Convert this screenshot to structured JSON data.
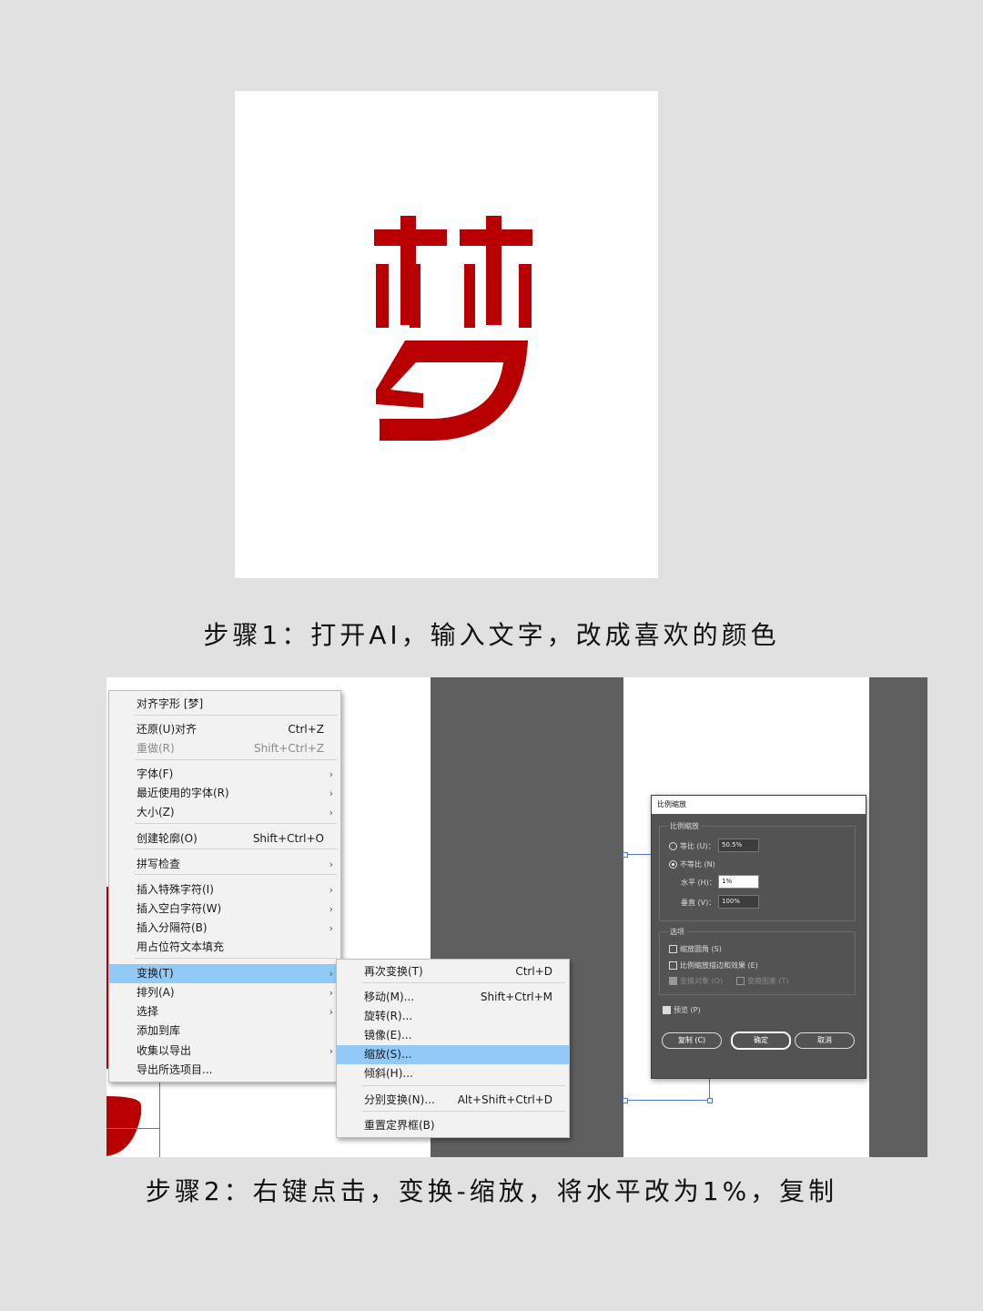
{
  "captions": {
    "step1": "步骤1：打开AI，输入文字，改成喜欢的颜色",
    "step2": "步骤2：右键点击，变换-缩放，将水平改为1%，复制"
  },
  "colors": {
    "glyph_red": "#b80003",
    "menu_highlight": "#91c9f7",
    "dialog_bg": "#535353"
  },
  "context_menu": {
    "items": [
      {
        "label": "对齐字形 [梦]",
        "shortcut": "",
        "arrow": false,
        "disabled": false
      },
      {
        "label": "还原(U)对齐",
        "shortcut": "Ctrl+Z",
        "arrow": false,
        "disabled": false
      },
      {
        "label": "重做(R)",
        "shortcut": "Shift+Ctrl+Z",
        "arrow": false,
        "disabled": true
      },
      {
        "label": "字体(F)",
        "shortcut": "",
        "arrow": true,
        "disabled": false
      },
      {
        "label": "最近使用的字体(R)",
        "shortcut": "",
        "arrow": true,
        "disabled": false
      },
      {
        "label": "大小(Z)",
        "shortcut": "",
        "arrow": true,
        "disabled": false
      },
      {
        "label": "创建轮廓(O)",
        "shortcut": "Shift+Ctrl+O",
        "arrow": false,
        "disabled": false
      },
      {
        "label": "拼写检查",
        "shortcut": "",
        "arrow": true,
        "disabled": false
      },
      {
        "label": "插入特殊字符(I)",
        "shortcut": "",
        "arrow": true,
        "disabled": false
      },
      {
        "label": "插入空白字符(W)",
        "shortcut": "",
        "arrow": true,
        "disabled": false
      },
      {
        "label": "插入分隔符(B)",
        "shortcut": "",
        "arrow": true,
        "disabled": false
      },
      {
        "label": "用占位符文本填充",
        "shortcut": "",
        "arrow": false,
        "disabled": false
      },
      {
        "label": "变换(T)",
        "shortcut": "",
        "arrow": true,
        "disabled": false,
        "highlighted": true
      },
      {
        "label": "排列(A)",
        "shortcut": "",
        "arrow": true,
        "disabled": false
      },
      {
        "label": "选择",
        "shortcut": "",
        "arrow": true,
        "disabled": false
      },
      {
        "label": "添加到库",
        "shortcut": "",
        "arrow": false,
        "disabled": false
      },
      {
        "label": "收集以导出",
        "shortcut": "",
        "arrow": true,
        "disabled": false
      },
      {
        "label": "导出所选项目...",
        "shortcut": "",
        "arrow": false,
        "disabled": false
      }
    ]
  },
  "submenu": {
    "items": [
      {
        "label": "再次变换(T)",
        "shortcut": "Ctrl+D"
      },
      {
        "label": "移动(M)...",
        "shortcut": "Shift+Ctrl+M"
      },
      {
        "label": "旋转(R)...",
        "shortcut": ""
      },
      {
        "label": "镜像(E)...",
        "shortcut": ""
      },
      {
        "label": "缩放(S)...",
        "shortcut": "",
        "highlighted": true
      },
      {
        "label": "倾斜(H)...",
        "shortcut": ""
      },
      {
        "label": "分别变换(N)...",
        "shortcut": "Alt+Shift+Ctrl+D"
      },
      {
        "label": "重置定界框(B)",
        "shortcut": ""
      }
    ]
  },
  "scale_dialog": {
    "title": "比例缩放",
    "group_scale": "比例缩放",
    "uniform_label": "等比 (U)：",
    "uniform_value": "50.5%",
    "nonuniform_label": "不等比 (N)",
    "horizontal_label": "水平 (H)：",
    "horizontal_value": "1%",
    "vertical_label": "垂直 (V)：",
    "vertical_value": "100%",
    "group_options": "选项",
    "scale_corners": "缩放圆角 (S)",
    "scale_strokes": "比例缩放描边和效果 (E)",
    "transform_objects": "变换对象 (O)",
    "transform_patterns": "变换图案 (T)",
    "preview": "预览 (P)",
    "copy_button": "复制 (C)",
    "ok_button": "确定",
    "cancel_button": "取消"
  }
}
